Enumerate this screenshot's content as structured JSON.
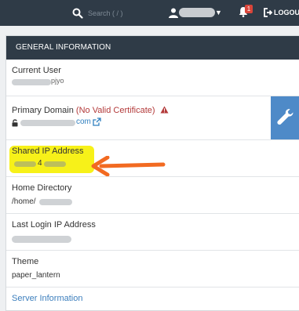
{
  "colors": {
    "topbar_bg": "#2f3b47",
    "panel_header_bg": "#2f3b47",
    "link": "#3d7fbd",
    "warning": "#b33a3a",
    "wrench_button_bg": "#4e8ac8",
    "highlight": "#f6f000",
    "annotation_arrow": "#f26a21"
  },
  "topbar": {
    "search_placeholder": "Search ( / )",
    "notification_count": "1",
    "logout_label": "LOGOUT"
  },
  "panel": {
    "title": "GENERAL INFORMATION",
    "current_user": {
      "label": "Current User",
      "value_visible": "pjyo"
    },
    "primary_domain": {
      "label": "Primary Domain",
      "warning": "(No Valid Certificate)",
      "value_visible": "com"
    },
    "shared_ip": {
      "label": "Shared IP Address",
      "value_visible": "4"
    },
    "home_directory": {
      "label": "Home Directory",
      "value_visible": "/home/"
    },
    "last_login_ip": {
      "label": "Last Login IP Address"
    },
    "theme": {
      "label": "Theme",
      "value": "paper_lantern"
    },
    "server_info_link": "Server Information"
  }
}
